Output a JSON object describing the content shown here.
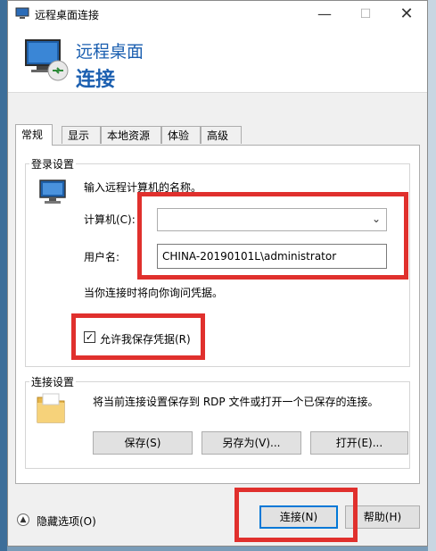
{
  "window": {
    "title": "远程桌面连接",
    "minimize_icon": "—",
    "maximize_icon": "☐",
    "close_icon": "✕"
  },
  "header": {
    "line1": "远程桌面",
    "line2": "连接"
  },
  "tabs": [
    "常规",
    "显示",
    "本地资源",
    "体验",
    "高级"
  ],
  "login": {
    "group_label": "登录设置",
    "instruction": "输入远程计算机的名称。",
    "computer_label": "计算机(C):",
    "computer_value": "",
    "user_label": "用户名:",
    "user_value": "CHINA-20190101L\\administrator",
    "credential_note": "当你连接时将向你询问凭据。",
    "save_credentials_label": "允许我保存凭据(R)",
    "save_credentials_checked": true
  },
  "connection": {
    "group_label": "连接设置",
    "description": "将当前连接设置保存到 RDP 文件或打开一个已保存的连接。",
    "save_button": "保存(S)",
    "save_as_button": "另存为(V)...",
    "open_button": "打开(E)..."
  },
  "footer": {
    "hide_options": "隐藏选项(O)",
    "connect_button": "连接(N)",
    "help_button": "帮助(H)"
  },
  "colors": {
    "accent": "#1b5fb0",
    "highlight_box": "#e0302d",
    "primary_border": "#0078d7"
  }
}
